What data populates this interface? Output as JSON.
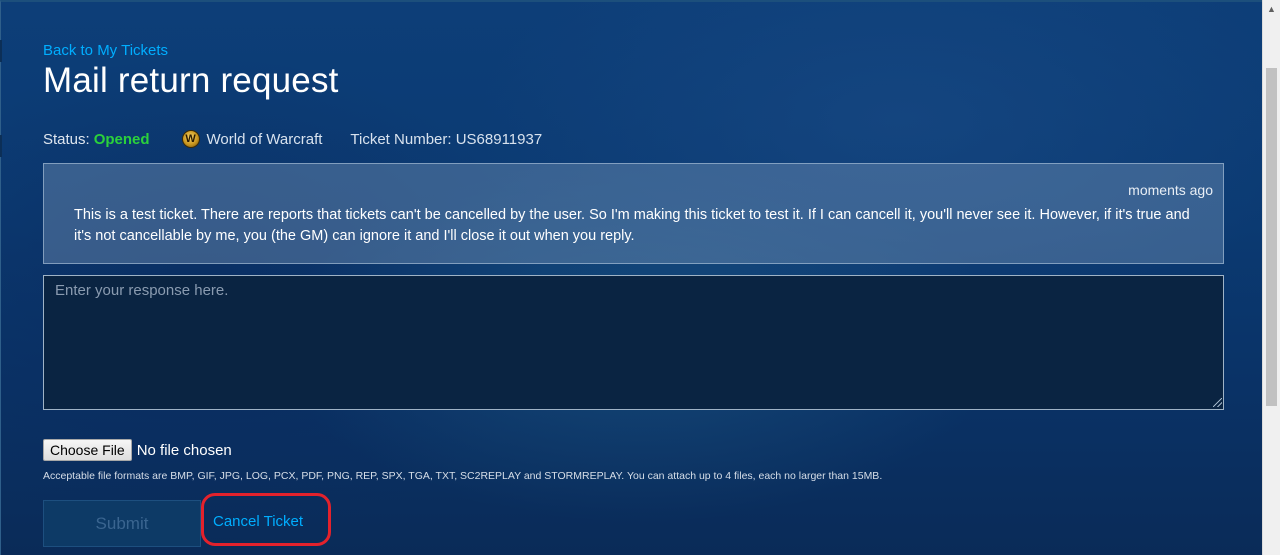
{
  "nav": {
    "back_link": "Back to My Tickets"
  },
  "ticket": {
    "title": "Mail return request",
    "status_label": "Status:",
    "status_value": "Opened",
    "game": "World of Warcraft",
    "game_icon": "wow-logo-icon",
    "ticket_number_label": "Ticket Number: US68911937"
  },
  "message": {
    "timestamp": "moments ago",
    "body": "This is a test ticket.  There are reports that tickets can't be cancelled by the user.  So I'm making this ticket to test it.  If I can cancell it, you'll never see it.  However, if it's true and it's not cancellable by me, you (the GM) can ignore it and I'll close it out when you reply."
  },
  "response": {
    "placeholder": "Enter your response here.",
    "value": ""
  },
  "attachment": {
    "choose_file_label": "Choose File",
    "no_file_text": "No file chosen",
    "formats_note": "Acceptable file formats are BMP, GIF, JPG, LOG, PCX, PDF, PNG, REP, SPX, TGA, TXT, SC2REPLAY and STORMREPLAY. You can attach up to 4 files, each no larger than 15MB."
  },
  "actions": {
    "submit_label": "Submit",
    "cancel_label": "Cancel Ticket"
  },
  "colors": {
    "link": "#00aeff",
    "status_opened": "#2bd13b",
    "highlight": "#e3222c"
  }
}
